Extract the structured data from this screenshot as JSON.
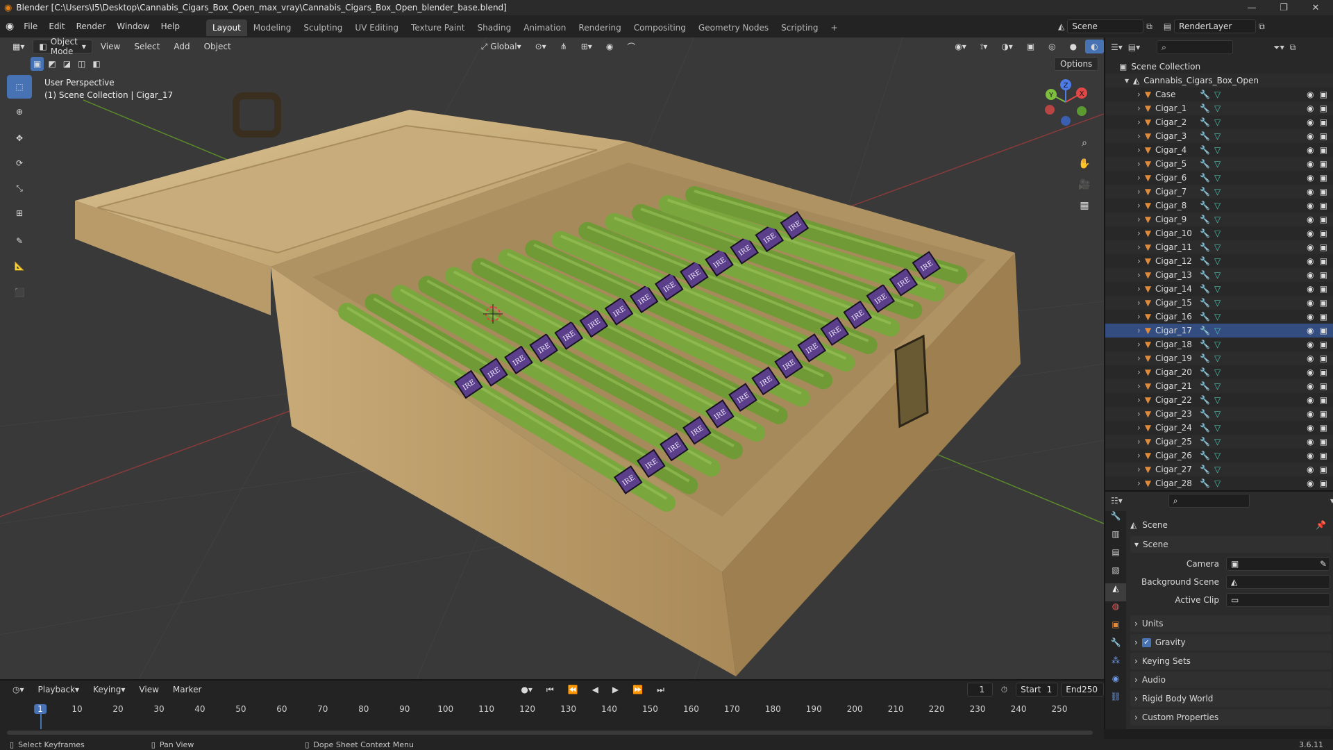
{
  "window": {
    "title": "Blender [C:\\Users\\I5\\Desktop\\Cannabis_Cigars_Box_Open_max_vray\\Cannabis_Cigars_Box_Open_blender_base.blend]",
    "minimize": "—",
    "maximize": "❐",
    "close": "✕"
  },
  "menus": [
    "File",
    "Edit",
    "Render",
    "Window",
    "Help"
  ],
  "workspaces": [
    "Layout",
    "Modeling",
    "Sculpting",
    "UV Editing",
    "Texture Paint",
    "Shading",
    "Animation",
    "Rendering",
    "Compositing",
    "Geometry Nodes",
    "Scripting"
  ],
  "active_workspace": "Layout",
  "add_workspace": "+",
  "scene_field": "Scene",
  "view_layer_field": "RenderLayer",
  "viewport": {
    "mode": "Object Mode",
    "menus": [
      "View",
      "Select",
      "Add",
      "Object"
    ],
    "transform_orientation": "Global",
    "options": "Options",
    "perspective_label": "User Perspective",
    "collection_label": "(1) Scene Collection | Cigar_17",
    "gizmo": {
      "x": "X",
      "y": "Y",
      "z": "Z"
    },
    "box_band_text": "IRE"
  },
  "outliner": {
    "root": "Scene Collection",
    "collection": "Cannabis_Cigars_Box_Open",
    "items": [
      "Case",
      "Cigar_1",
      "Cigar_2",
      "Cigar_3",
      "Cigar_4",
      "Cigar_5",
      "Cigar_6",
      "Cigar_7",
      "Cigar_8",
      "Cigar_9",
      "Cigar_10",
      "Cigar_11",
      "Cigar_12",
      "Cigar_13",
      "Cigar_14",
      "Cigar_15",
      "Cigar_16",
      "Cigar_17",
      "Cigar_18",
      "Cigar_19",
      "Cigar_20",
      "Cigar_21",
      "Cigar_22",
      "Cigar_23",
      "Cigar_24",
      "Cigar_25",
      "Cigar_26",
      "Cigar_27",
      "Cigar_28"
    ],
    "selected": "Cigar_17"
  },
  "properties": {
    "header": "Scene",
    "panel": "Scene",
    "camera_label": "Camera",
    "background_scene_label": "Background Scene",
    "active_clip_label": "Active Clip",
    "collapsed_panels": [
      "Units",
      "Gravity",
      "Keying Sets",
      "Audio",
      "Rigid Body World",
      "Custom Properties"
    ],
    "gravity_checked": true
  },
  "timeline": {
    "menus": [
      "Playback",
      "Keying",
      "View",
      "Marker"
    ],
    "current_frame": "1",
    "start_label": "Start",
    "start": "1",
    "end_label": "End",
    "end": "250",
    "ticks": [
      "1",
      "10",
      "20",
      "30",
      "40",
      "50",
      "60",
      "70",
      "80",
      "90",
      "100",
      "110",
      "120",
      "130",
      "140",
      "150",
      "160",
      "170",
      "180",
      "190",
      "200",
      "210",
      "220",
      "230",
      "240",
      "250"
    ]
  },
  "statusbar": {
    "select": "Select Keyframes",
    "pan": "Pan View",
    "context": "Dope Sheet Context Menu",
    "version": "3.6.11"
  },
  "colors": {
    "accent": "#4772b3",
    "selected_row": "#334d80",
    "object_icon": "#e08a3c",
    "mesh_icon": "#4fc3b0",
    "modifier_icon": "#6f9be8",
    "wood": "#c9ad7e",
    "cigar_green": "#6f9a36"
  }
}
